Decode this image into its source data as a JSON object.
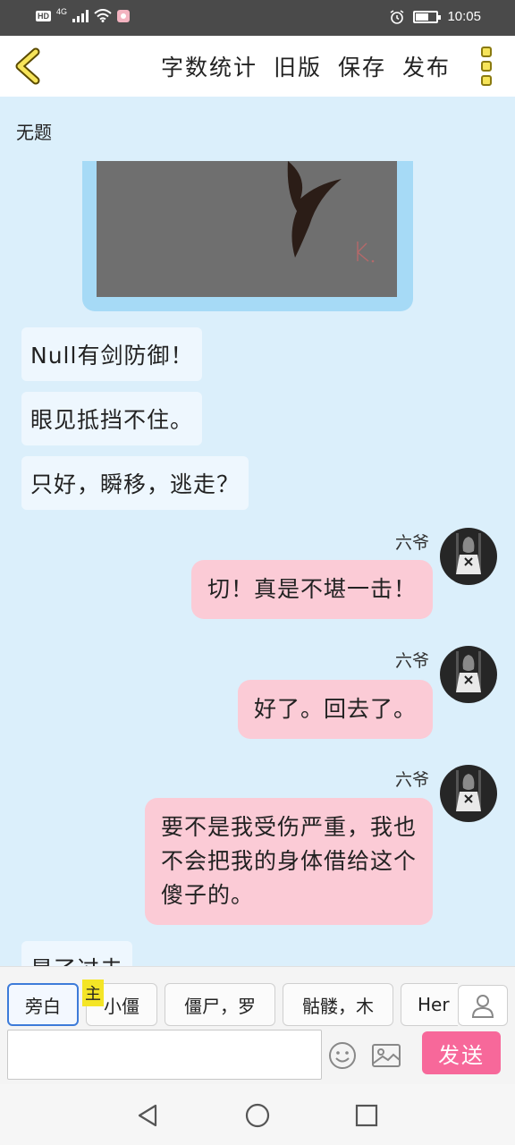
{
  "status_bar": {
    "network_badge": "HD",
    "network_type": "4G",
    "time": "10:05"
  },
  "toolbar": {
    "actions": [
      "字数统计",
      "旧版",
      "保存",
      "发布"
    ]
  },
  "document": {
    "title": "无题"
  },
  "messages": {
    "narration": [
      "Null有剑防御！",
      "眼见抵挡不住。",
      "只好，瞬移，逃走？"
    ],
    "partial_text": "是了过去",
    "right": [
      {
        "name": "六爷",
        "lines": [
          "切！真是不堪一击！"
        ]
      },
      {
        "name": "六爷",
        "lines": [
          "好了。回去了。"
        ]
      },
      {
        "name": "六爷",
        "lines": [
          "要不是我受伤严重，我也",
          "不会把我的身体借给这个",
          "傻子的。"
        ]
      }
    ]
  },
  "composer": {
    "tabs": [
      "旁白",
      "小僵",
      "僵尸，罗",
      "骷髅，木",
      "Her"
    ],
    "owner_badge": "主",
    "input_value": "",
    "send_label": "发送"
  },
  "colors": {
    "right_bubble": "#fbcbd6",
    "left_bubble": "#eef7fe",
    "send_button": "#f7689a",
    "background": "#dbeffb"
  }
}
